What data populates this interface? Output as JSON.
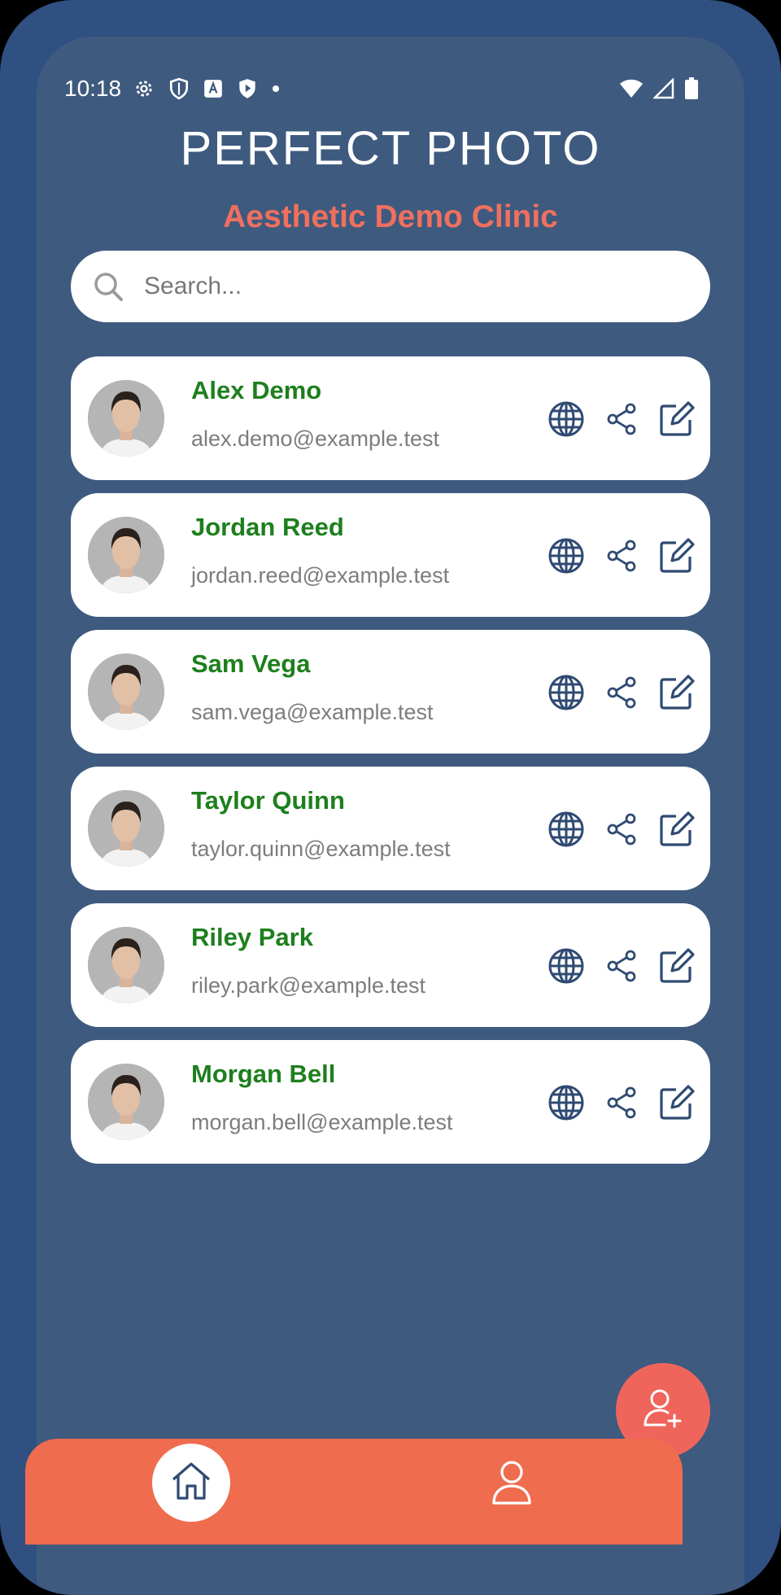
{
  "status_bar": {
    "time": "10:18",
    "left_icons": [
      "gear-icon",
      "shield-icon",
      "font-a-icon",
      "play-shield-icon",
      "dot-icon"
    ],
    "right_icons": [
      "wifi-icon",
      "signal-icon",
      "battery-icon"
    ]
  },
  "brand": {
    "logo": "PERFECT PHOTO",
    "clinic": "Aesthetic Demo Clinic"
  },
  "search": {
    "placeholder": "Search...",
    "value": ""
  },
  "patients": [
    {
      "name": "Alex Demo",
      "email": "alex.demo@example.test"
    },
    {
      "name": "Jordan Reed",
      "email": "jordan.reed@example.test"
    },
    {
      "name": "Sam Vega",
      "email": "sam.vega@example.test"
    },
    {
      "name": "Taylor Quinn",
      "email": "taylor.quinn@example.test"
    },
    {
      "name": "Riley Park",
      "email": "riley.park@example.test"
    },
    {
      "name": "Morgan Bell",
      "email": "morgan.bell@example.test"
    }
  ],
  "card_actions": [
    "globe-icon",
    "share-icon",
    "edit-icon"
  ],
  "fab": {
    "icon": "add-user-icon"
  },
  "bottom_nav": {
    "items": [
      {
        "icon": "home-icon",
        "active": true
      },
      {
        "icon": "user-icon",
        "active": false
      }
    ]
  },
  "colors": {
    "background": "#3f5a7f",
    "frame": "#2f5080",
    "accent": "#f0705e",
    "name_green": "#1d7f1d",
    "nav": "#ef6c4f",
    "icon_navy": "#2f4a72"
  }
}
